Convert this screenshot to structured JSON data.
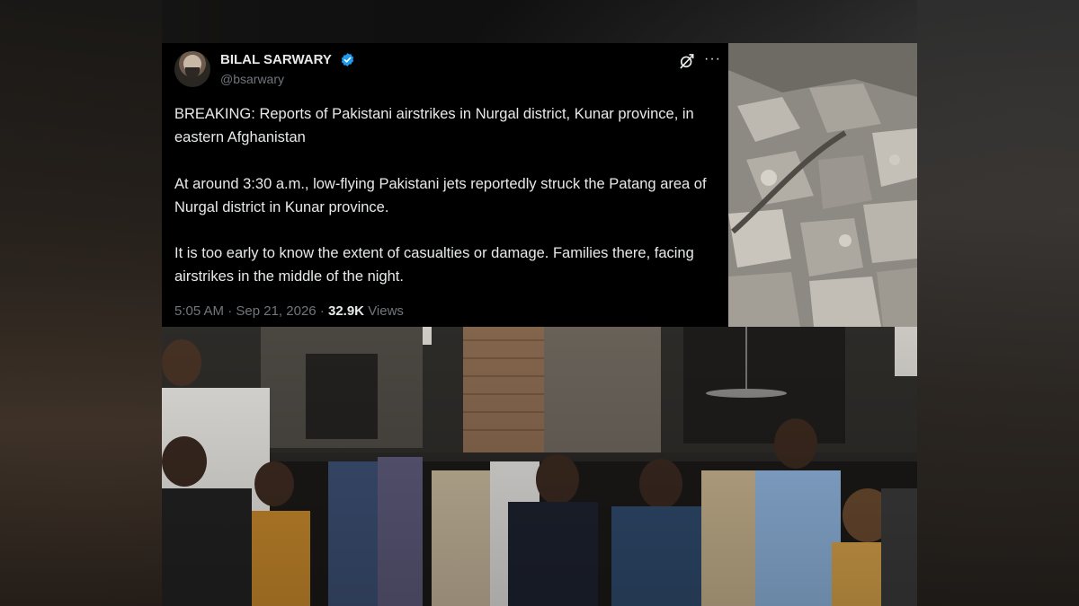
{
  "tweet": {
    "author_name": "BILAL SARWARY",
    "handle": "@bsarwary",
    "paragraphs": [
      "BREAKING: Reports of Pakistani airstrikes in Nurgal district, Kunar province, in eastern Afghanistan",
      "At around 3:30 a.m., low-flying Pakistani jets reportedly struck the Patang area of Nurgal district in Kunar province.",
      "It is too early to know the extent of casualties or damage. Families there, facing airstrikes in the middle of the night."
    ],
    "time": "5:05 AM",
    "separator": "·",
    "date": "Sep 21, 2026",
    "views_count": "32.9K",
    "views_label": "Views",
    "more_label": "···"
  },
  "icons": {
    "verified": "verified-badge-icon",
    "grok": "grok-icon",
    "more": "more-options-icon"
  },
  "colors": {
    "tweet_background": "#000000",
    "text_primary": "#e7e9ea",
    "text_secondary": "#71767b",
    "verified_blue": "#1d9bf0"
  }
}
